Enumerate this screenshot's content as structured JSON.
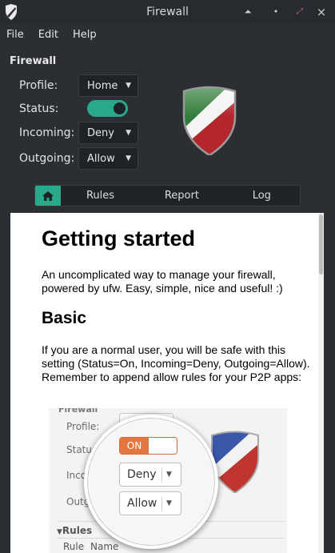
{
  "window": {
    "title": "Firewall"
  },
  "menu": [
    "File",
    "Edit",
    "Help"
  ],
  "section_title": "Firewall",
  "profile": {
    "label": "Profile:",
    "value": "Home"
  },
  "status": {
    "label": "Status:",
    "on": true
  },
  "incoming": {
    "label": "Incoming:",
    "value": "Deny"
  },
  "outgoing": {
    "label": "Outgoing:",
    "value": "Allow"
  },
  "tabs": [
    "Rules",
    "Report",
    "Log"
  ],
  "doc": {
    "h1": "Getting started",
    "p1": "An uncomplicated way to manage your firewall, powered by ufw. Easy, simple, nice and useful! :)",
    "h2": "Basic",
    "p2": "If you are a normal user, you will be safe with this setting (Status=On, Incoming=Deny, Outgoing=Allow). Remember to append allow rules for your P2P apps:"
  },
  "preview": {
    "firewall": "Firewall",
    "profile_label": "Profile:",
    "status_label": "Status:",
    "incoming_label": "Incoming:",
    "outgoing_label": "Outgoing:",
    "status_value": "ON",
    "incoming_value": "Deny",
    "outgoing_value": "Allow",
    "rules_header": "Rules",
    "col_rule": "Rule",
    "col_name": "Name"
  },
  "colors": {
    "accent": "#2aa88a",
    "background": "#2b2e33",
    "preview_toggle": "#e3763f"
  }
}
